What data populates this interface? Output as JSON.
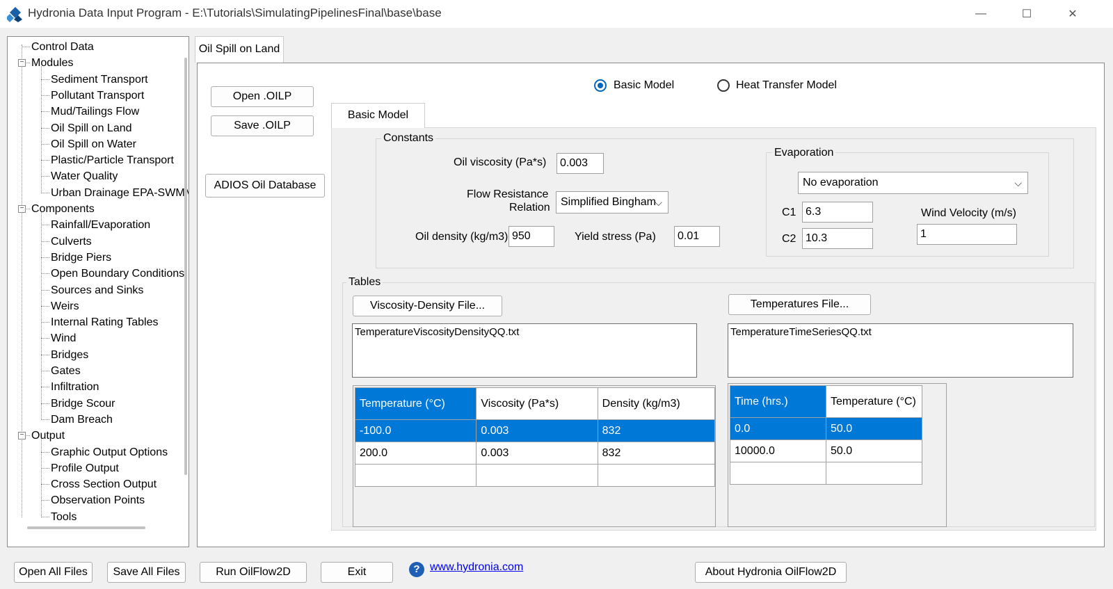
{
  "window": {
    "title": "Hydronia Data Input Program - E:\\Tutorials\\SimulatingPipelinesFinal\\base\\base",
    "controls": {
      "minimize": "—",
      "maximize": "☐",
      "close": "✕"
    }
  },
  "tree": {
    "items": [
      {
        "label": "Control Data",
        "level": 0
      },
      {
        "label": "Modules",
        "level": 0,
        "expander": "⊟"
      },
      {
        "label": "Sediment Transport",
        "level": 1
      },
      {
        "label": "Pollutant Transport",
        "level": 1
      },
      {
        "label": "Mud/Tailings Flow",
        "level": 1
      },
      {
        "label": "Oil Spill on Land",
        "level": 1
      },
      {
        "label": "Oil Spill on Water",
        "level": 1
      },
      {
        "label": "Plastic/Particle Transport",
        "level": 1
      },
      {
        "label": "Water Quality",
        "level": 1
      },
      {
        "label": "Urban Drainage EPA-SWMM",
        "level": 1
      },
      {
        "label": "Components",
        "level": 0,
        "expander": "⊟"
      },
      {
        "label": "Rainfall/Evaporation",
        "level": 1
      },
      {
        "label": "Culverts",
        "level": 1
      },
      {
        "label": "Bridge Piers",
        "level": 1
      },
      {
        "label": "Open Boundary Conditions",
        "level": 1
      },
      {
        "label": "Sources and Sinks",
        "level": 1
      },
      {
        "label": "Weirs",
        "level": 1
      },
      {
        "label": "Internal Rating Tables",
        "level": 1
      },
      {
        "label": "Wind",
        "level": 1
      },
      {
        "label": "Bridges",
        "level": 1
      },
      {
        "label": "Gates",
        "level": 1
      },
      {
        "label": "Infiltration",
        "level": 1
      },
      {
        "label": "Bridge Scour",
        "level": 1
      },
      {
        "label": "Dam Breach",
        "level": 1
      },
      {
        "label": "Output",
        "level": 0,
        "expander": "⊟"
      },
      {
        "label": "Graphic Output Options",
        "level": 1
      },
      {
        "label": "Profile Output",
        "level": 1
      },
      {
        "label": "Cross Section Output",
        "level": 1
      },
      {
        "label": "Observation Points",
        "level": 1
      },
      {
        "label": "Tools",
        "level": 1
      }
    ]
  },
  "main": {
    "tab": "Oil Spill on Land",
    "buttons": {
      "open_oilp": "Open .OILP",
      "save_oilp": "Save .OILP",
      "adios": "ADIOS Oil Database"
    },
    "model": {
      "basic": "Basic Model",
      "heat": "Heat Transfer Model",
      "selected": "basic"
    },
    "inner_tab": "Basic Model",
    "constants": {
      "legend": "Constants",
      "oil_viscosity_label": "Oil viscosity (Pa*s)",
      "oil_viscosity": "0.003",
      "flow_resistance_label_1": "Flow Resistance",
      "flow_resistance_label_2": "Relation",
      "flow_resistance": "Simplified Bingham",
      "oil_density_label": "Oil density (kg/m3)",
      "oil_density": "950",
      "yield_stress_label": "Yield stress (Pa)",
      "yield_stress": "0.01",
      "evaporation": {
        "legend": "Evaporation",
        "selected": "No evaporation",
        "c1_label": "C1",
        "c1": "6.3",
        "c2_label": "C2",
        "c2": "10.3",
        "wind_label": "Wind Velocity (m/s)",
        "wind": "1"
      }
    },
    "tables": {
      "legend": "Tables",
      "viscosity_button": "Viscosity-Density File...",
      "viscosity_file": "TemperatureViscosityDensityQQ.txt",
      "temperatures_button": "Temperatures File...",
      "temperatures_file": "TemperatureTimeSeriesQQ.txt",
      "vd_grid": {
        "headers": [
          "Temperature (°C)",
          "Viscosity (Pa*s)",
          "Density (kg/m3)"
        ],
        "rows": [
          [
            "-100.0",
            "0.003",
            "832"
          ],
          [
            "200.0",
            "0.003",
            "832"
          ]
        ]
      },
      "ts_grid": {
        "headers": [
          "Time (hrs.)",
          "Temperature (°C)"
        ],
        "rows": [
          [
            "0.0",
            "50.0"
          ],
          [
            "10000.0",
            "50.0"
          ]
        ]
      }
    }
  },
  "bottom": {
    "open_all": "Open All Files",
    "save_all": "Save All Files",
    "run": "Run OilFlow2D",
    "exit": "Exit",
    "help_icon": "?",
    "website": "www.hydronia.com",
    "about": "About Hydronia OilFlow2D"
  }
}
